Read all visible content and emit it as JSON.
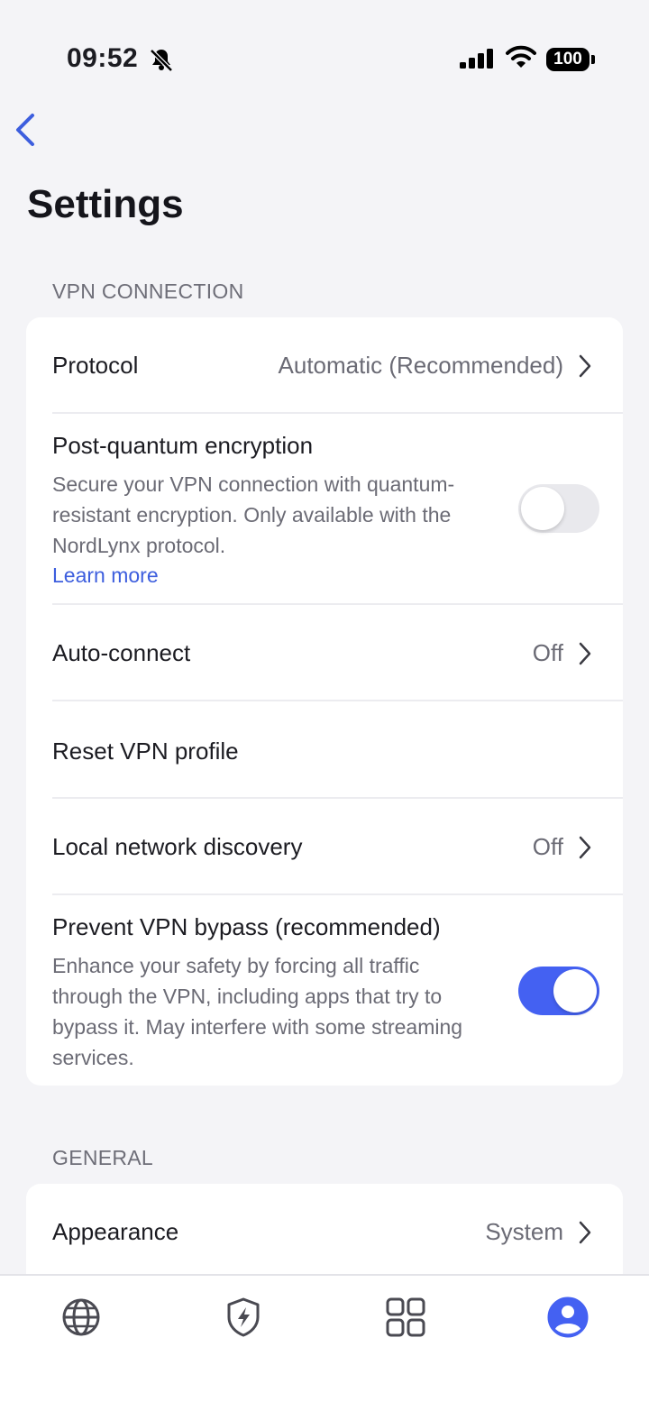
{
  "status_bar": {
    "time": "09:52",
    "battery": "100",
    "icons": [
      "bell-slash-icon",
      "cellular-signal-icon",
      "wifi-icon",
      "battery-icon"
    ]
  },
  "nav": {
    "back_icon": "chevron-left-icon"
  },
  "page": {
    "title": "Settings"
  },
  "vpn_section": {
    "label": "VPN CONNECTION",
    "protocol": {
      "label": "Protocol",
      "value": "Automatic (Recommended)"
    },
    "pq": {
      "label": "Post-quantum encryption",
      "desc_lines": [
        "Secure your VPN connection with quantum-",
        "resistant encryption. Only available with the",
        "NordLynx protocol."
      ],
      "link": "Learn more",
      "enabled": false
    },
    "auto_connect": {
      "label": "Auto-connect",
      "value": "Off"
    },
    "reset": {
      "label": "Reset VPN profile"
    },
    "local_discovery": {
      "label": "Local network discovery",
      "value": "Off"
    },
    "bypass": {
      "label": "Prevent VPN bypass (recommended)",
      "desc_lines": [
        "Enhance your safety by forcing all traffic",
        "through the VPN, including apps that try to",
        "bypass it. May interfere with some streaming",
        "services."
      ],
      "enabled": true
    }
  },
  "general_section": {
    "label": "GENERAL",
    "appearance": {
      "label": "Appearance",
      "value": "System"
    }
  },
  "tab_bar": {
    "tabs": [
      {
        "icon": "globe-icon"
      },
      {
        "icon": "shield-bolt-icon"
      },
      {
        "icon": "grid-icon"
      },
      {
        "icon": "profile-icon",
        "active": true
      }
    ]
  },
  "colors": {
    "accent": "#4461f2",
    "link": "#3d5ede",
    "background": "#f4f4f7"
  }
}
